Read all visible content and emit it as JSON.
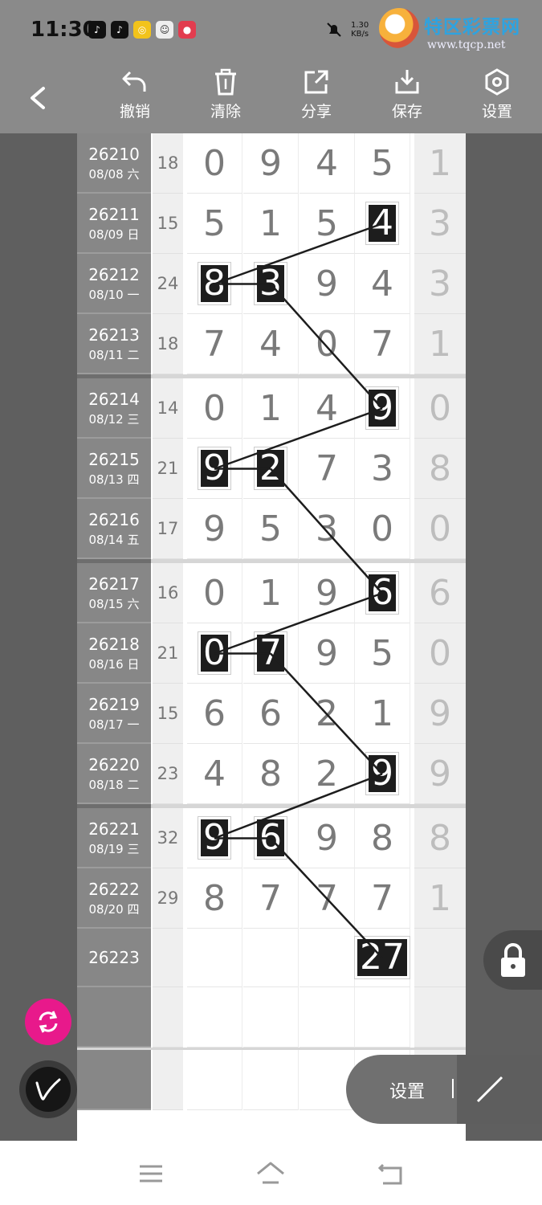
{
  "status_bar": {
    "time": "11:30",
    "net_speed_value": "1.30",
    "net_speed_unit": "KB/s"
  },
  "watermark": {
    "site_name": "特区彩票网",
    "url": "www.tqcp.net"
  },
  "toolbar": {
    "undo_label": "撤销",
    "clear_label": "清除",
    "share_label": "分享",
    "save_label": "保存",
    "settings_label": "设置"
  },
  "rows": [
    {
      "period": "26210",
      "date": "08/08 六",
      "sum": "18",
      "digits": [
        "0",
        "9",
        "4",
        "5"
      ],
      "last": "1",
      "highlight": []
    },
    {
      "period": "26211",
      "date": "08/09 日",
      "sum": "15",
      "digits": [
        "5",
        "1",
        "5",
        "4"
      ],
      "last": "3",
      "highlight": [
        3
      ]
    },
    {
      "period": "26212",
      "date": "08/10 一",
      "sum": "24",
      "digits": [
        "8",
        "3",
        "9",
        "4"
      ],
      "last": "3",
      "highlight": [
        0,
        1
      ]
    },
    {
      "period": "26213",
      "date": "08/11 二",
      "sum": "18",
      "digits": [
        "7",
        "4",
        "0",
        "7"
      ],
      "last": "1",
      "highlight": []
    },
    {
      "period": "26214",
      "date": "08/12 三",
      "sum": "14",
      "digits": [
        "0",
        "1",
        "4",
        "9"
      ],
      "last": "0",
      "highlight": [
        3
      ]
    },
    {
      "period": "26215",
      "date": "08/13 四",
      "sum": "21",
      "digits": [
        "9",
        "2",
        "7",
        "3"
      ],
      "last": "8",
      "highlight": [
        0,
        1
      ]
    },
    {
      "period": "26216",
      "date": "08/14 五",
      "sum": "17",
      "digits": [
        "9",
        "5",
        "3",
        "0"
      ],
      "last": "0",
      "highlight": []
    },
    {
      "period": "26217",
      "date": "08/15 六",
      "sum": "16",
      "digits": [
        "0",
        "1",
        "9",
        "6"
      ],
      "last": "6",
      "highlight": [
        3
      ]
    },
    {
      "period": "26218",
      "date": "08/16 日",
      "sum": "21",
      "digits": [
        "0",
        "7",
        "9",
        "5"
      ],
      "last": "0",
      "highlight": [
        0,
        1
      ]
    },
    {
      "period": "26219",
      "date": "08/17 一",
      "sum": "15",
      "digits": [
        "6",
        "6",
        "2",
        "1"
      ],
      "last": "9",
      "highlight": []
    },
    {
      "period": "26220",
      "date": "08/18 二",
      "sum": "23",
      "digits": [
        "4",
        "8",
        "2",
        "9"
      ],
      "last": "9",
      "highlight": [
        3
      ]
    },
    {
      "period": "26221",
      "date": "08/19 三",
      "sum": "32",
      "digits": [
        "9",
        "6",
        "9",
        "8"
      ],
      "last": "8",
      "highlight": [
        0,
        1
      ]
    },
    {
      "period": "26222",
      "date": "08/20 四",
      "sum": "29",
      "digits": [
        "8",
        "7",
        "7",
        "7"
      ],
      "last": "1",
      "highlight": []
    },
    {
      "period": "26223",
      "date": "",
      "sum": "",
      "digits": [
        "",
        "",
        "",
        "27"
      ],
      "last": "",
      "highlight": [
        3
      ]
    },
    {
      "period": "",
      "date": "",
      "sum": "",
      "digits": [
        "",
        "",
        "",
        ""
      ],
      "last": "",
      "highlight": []
    },
    {
      "period": "",
      "date": "",
      "sum": "",
      "digits": [
        "",
        "",
        "",
        ""
      ],
      "last": "",
      "highlight": []
    }
  ],
  "floating": {
    "settings_label": "设置"
  }
}
